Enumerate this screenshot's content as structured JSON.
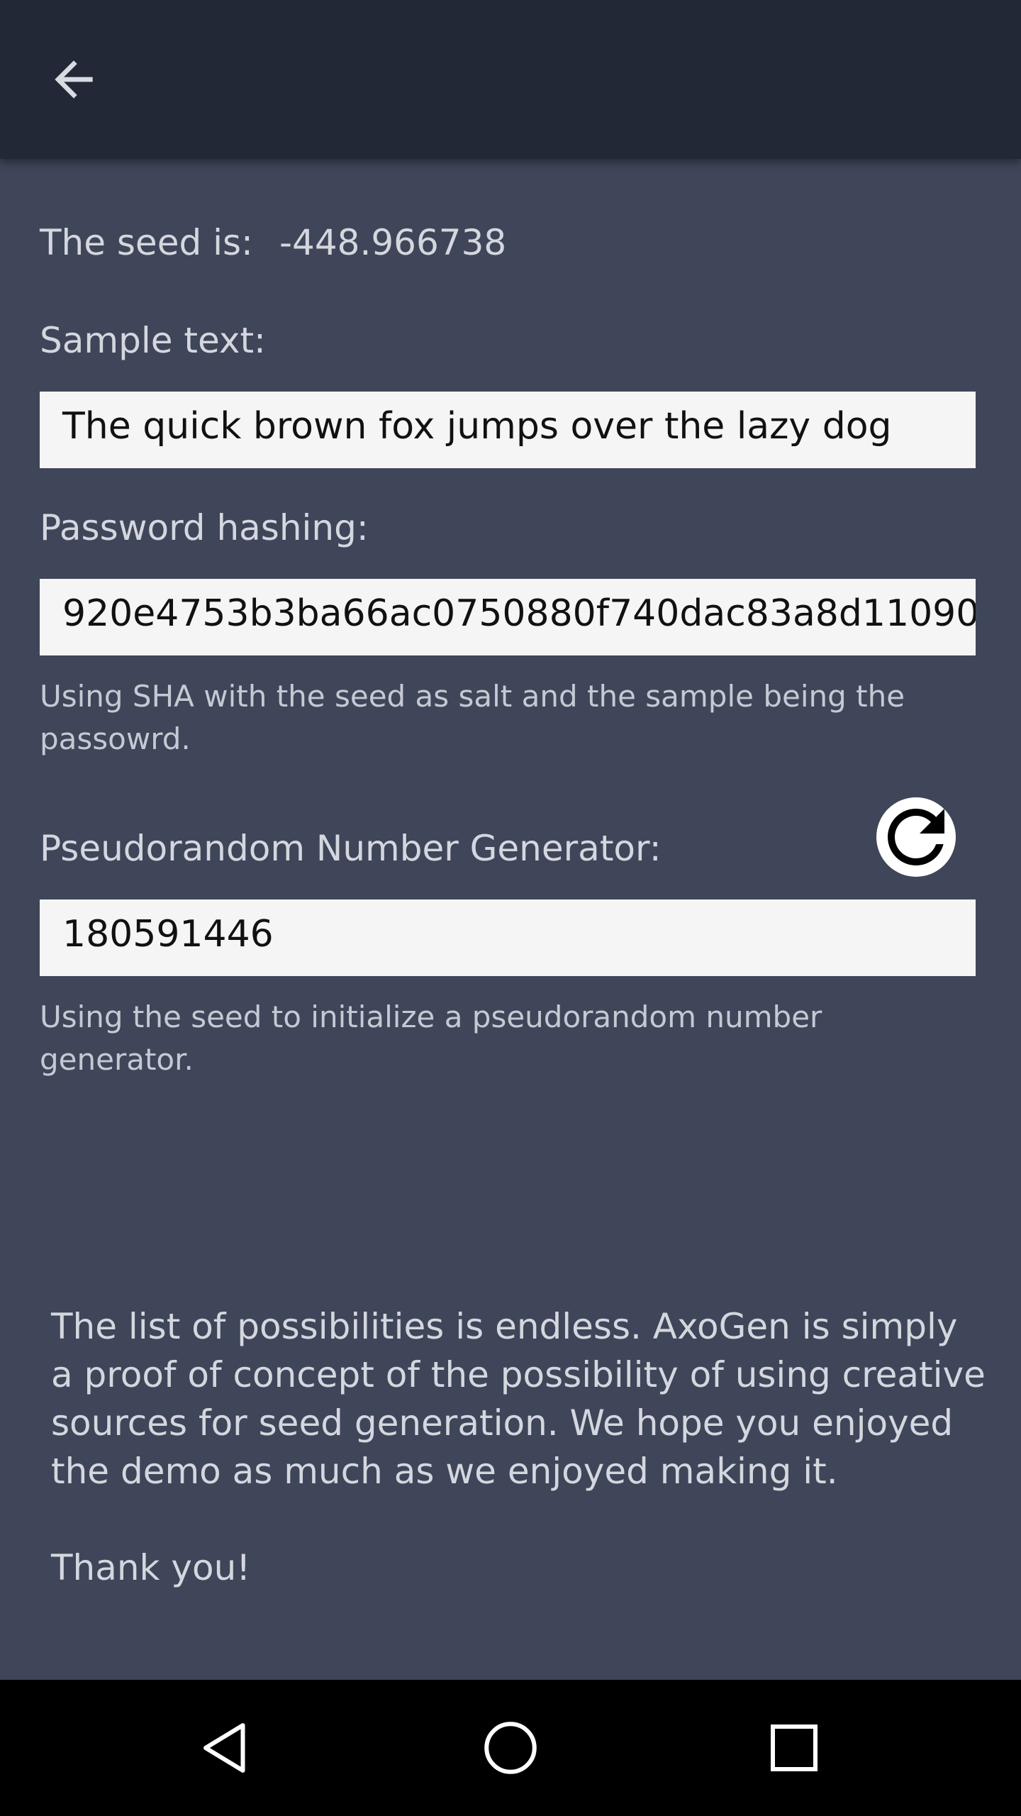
{
  "app_bar": {
    "back_icon": "arrow-back-icon"
  },
  "seed": {
    "label": "The seed is:",
    "value": "-448.966738"
  },
  "sample": {
    "label": "Sample text:",
    "value": "The quick brown fox jumps over the lazy dog"
  },
  "hashing": {
    "label": "Password hashing:",
    "value": "920e4753b3ba66ac0750880f740dac83a8d11090",
    "helper": "Using SHA with the seed as salt and the sample being the passowrd."
  },
  "prng": {
    "label": "Pseudorandom Number Generator:",
    "value": "180591446",
    "helper": "Using the seed to initialize a pseudorandom number generator.",
    "refresh_icon": "refresh-icon"
  },
  "closing": {
    "paragraph": "The list of possibilities is endless. AxoGen is simply a proof of concept of the possibility of using creative sources for seed generation. We hope you enjoyed the demo as much as we enjoyed making it.",
    "thanks": "Thank you!"
  },
  "nav_bar": {
    "back_icon": "nav-back-icon",
    "home_icon": "nav-home-icon",
    "recents_icon": "nav-recents-icon"
  },
  "colors": {
    "app_bar": "#232836",
    "background": "#3f4659",
    "field": "#f5f5f5",
    "text": "#d4d7de",
    "nav_bar": "#000000"
  }
}
